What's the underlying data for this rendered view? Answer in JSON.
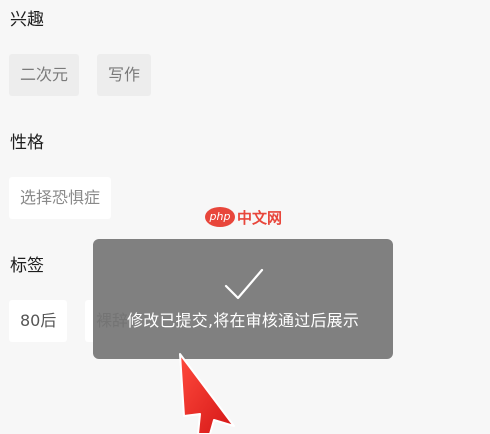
{
  "sections": {
    "interests": {
      "title": "兴趣",
      "chips": [
        "二次元",
        "写作"
      ]
    },
    "personality": {
      "title": "性格",
      "placeholder": "选择恐惧症"
    },
    "tags": {
      "title": "标签",
      "chips": [
        "80后",
        "裸辞"
      ]
    }
  },
  "toast": {
    "icon": "checkmark-icon",
    "message": "修改已提交,将在审核通过后展示"
  },
  "watermark": {
    "logo": "php",
    "text": "中文网"
  },
  "colors": {
    "background": "#f7f7f7",
    "toast_background": "#767676",
    "watermark": "#e8463b",
    "arrow": "#e8231f"
  }
}
